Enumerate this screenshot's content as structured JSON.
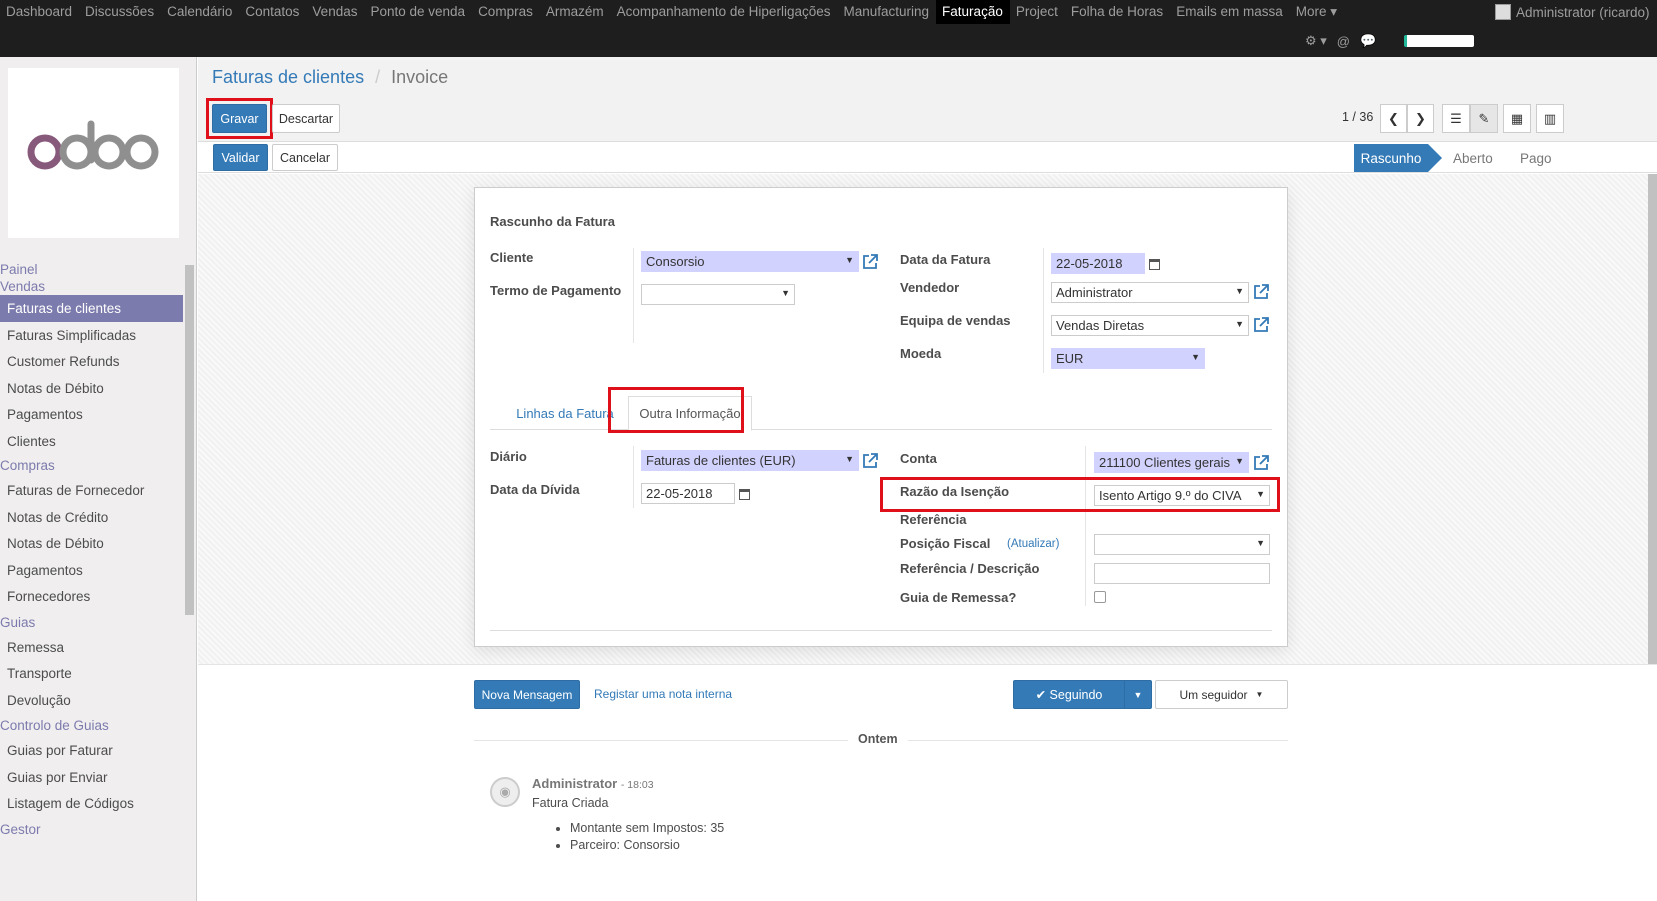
{
  "topmenu": {
    "items": [
      "Dashboard",
      "Discussões",
      "Calendário",
      "Contatos",
      "Vendas",
      "Ponto de venda",
      "Compras",
      "Armazém",
      "Acompanhamento de Hiperligações",
      "Manufacturing",
      "Faturação",
      "Project",
      "Folha de Horas",
      "Emails em massa",
      "More ▾"
    ],
    "active": "Faturação",
    "user": "Administrator (ricardo)",
    "systray": [
      "⚙ ▾",
      "@",
      "💬"
    ]
  },
  "sidebar": {
    "logo_text": "odoo",
    "sections": [
      {
        "title": "Painel",
        "items": []
      },
      {
        "title": "Vendas",
        "items": [
          "Faturas de clientes",
          "Faturas Simplificadas",
          "Customer Refunds",
          "Notas de Débito",
          "Pagamentos",
          "Clientes"
        ]
      },
      {
        "title": "Compras",
        "items": [
          "Faturas de Fornecedor",
          "Notas de Crédito",
          "Notas de Débito",
          "Pagamentos",
          "Fornecedores"
        ]
      },
      {
        "title": "Guias",
        "items": [
          "Remessa",
          "Transporte",
          "Devolução"
        ]
      },
      {
        "title": "Controlo de Guias",
        "items": [
          "Guias por Faturar",
          "Guias por Enviar",
          "Listagem de Códigos"
        ]
      },
      {
        "title": "Gestor",
        "items": []
      }
    ],
    "active_item": "Faturas de clientes"
  },
  "control_panel": {
    "breadcrumb_parent": "Faturas de clientes",
    "breadcrumb_sep": "/",
    "breadcrumb_current": "Invoice",
    "save_label": "Gravar",
    "discard_label": "Descartar",
    "pager": "1 / 36",
    "validate_label": "Validar",
    "cancel_label": "Cancelar"
  },
  "statusbar": {
    "stages": [
      "Rascunho",
      "Aberto",
      "Pago"
    ],
    "active": "Rascunho"
  },
  "form": {
    "title": "Rascunho da Fatura",
    "cliente_label": "Cliente",
    "cliente_value": "Consorsio",
    "termo_label": "Termo de Pagamento",
    "termo_value": "",
    "data_fatura_label": "Data da Fatura",
    "data_fatura_value": "22-05-2018",
    "vendedor_label": "Vendedor",
    "vendedor_value": "Administrator",
    "equipa_label": "Equipa de vendas",
    "equipa_value": "Vendas Diretas",
    "moeda_label": "Moeda",
    "moeda_value": "EUR",
    "tabs": [
      "Linhas da Fatura",
      "Outra Informação"
    ],
    "active_tab": "Outra Informação",
    "diario_label": "Diário",
    "diario_value": "Faturas de clientes (EUR)",
    "data_divida_label": "Data da Dívida",
    "data_divida_value": "22-05-2018",
    "conta_label": "Conta",
    "conta_value": "211100 Clientes gerais",
    "razao_label": "Razão da Isenção",
    "razao_value": "Isento Artigo 9.º do CIVA",
    "referencia_label": "Referência",
    "posicao_label": "Posição Fiscal",
    "posicao_update": "(Atualizar)",
    "posicao_value": "",
    "refdesc_label": "Referência / Descrição",
    "refdesc_value": "",
    "guia_label": "Guia de Remessa?"
  },
  "chatter": {
    "new_message": "Nova Mensagem",
    "log_note": "Registar uma nota interna",
    "following": "✔ Seguindo",
    "followers": "Um seguidor",
    "date_sep": "Ontem",
    "author": "Administrator",
    "time": "- 18:03",
    "message": "Fatura Criada",
    "bullets": [
      "Montante sem Impostos: 35",
      "Parceiro: Consorsio"
    ]
  },
  "colors": {
    "primary": "#337ab7",
    "sidebar_active": "#7c7bad",
    "required": "#d2d2ff",
    "highlight": "#e0101a"
  }
}
